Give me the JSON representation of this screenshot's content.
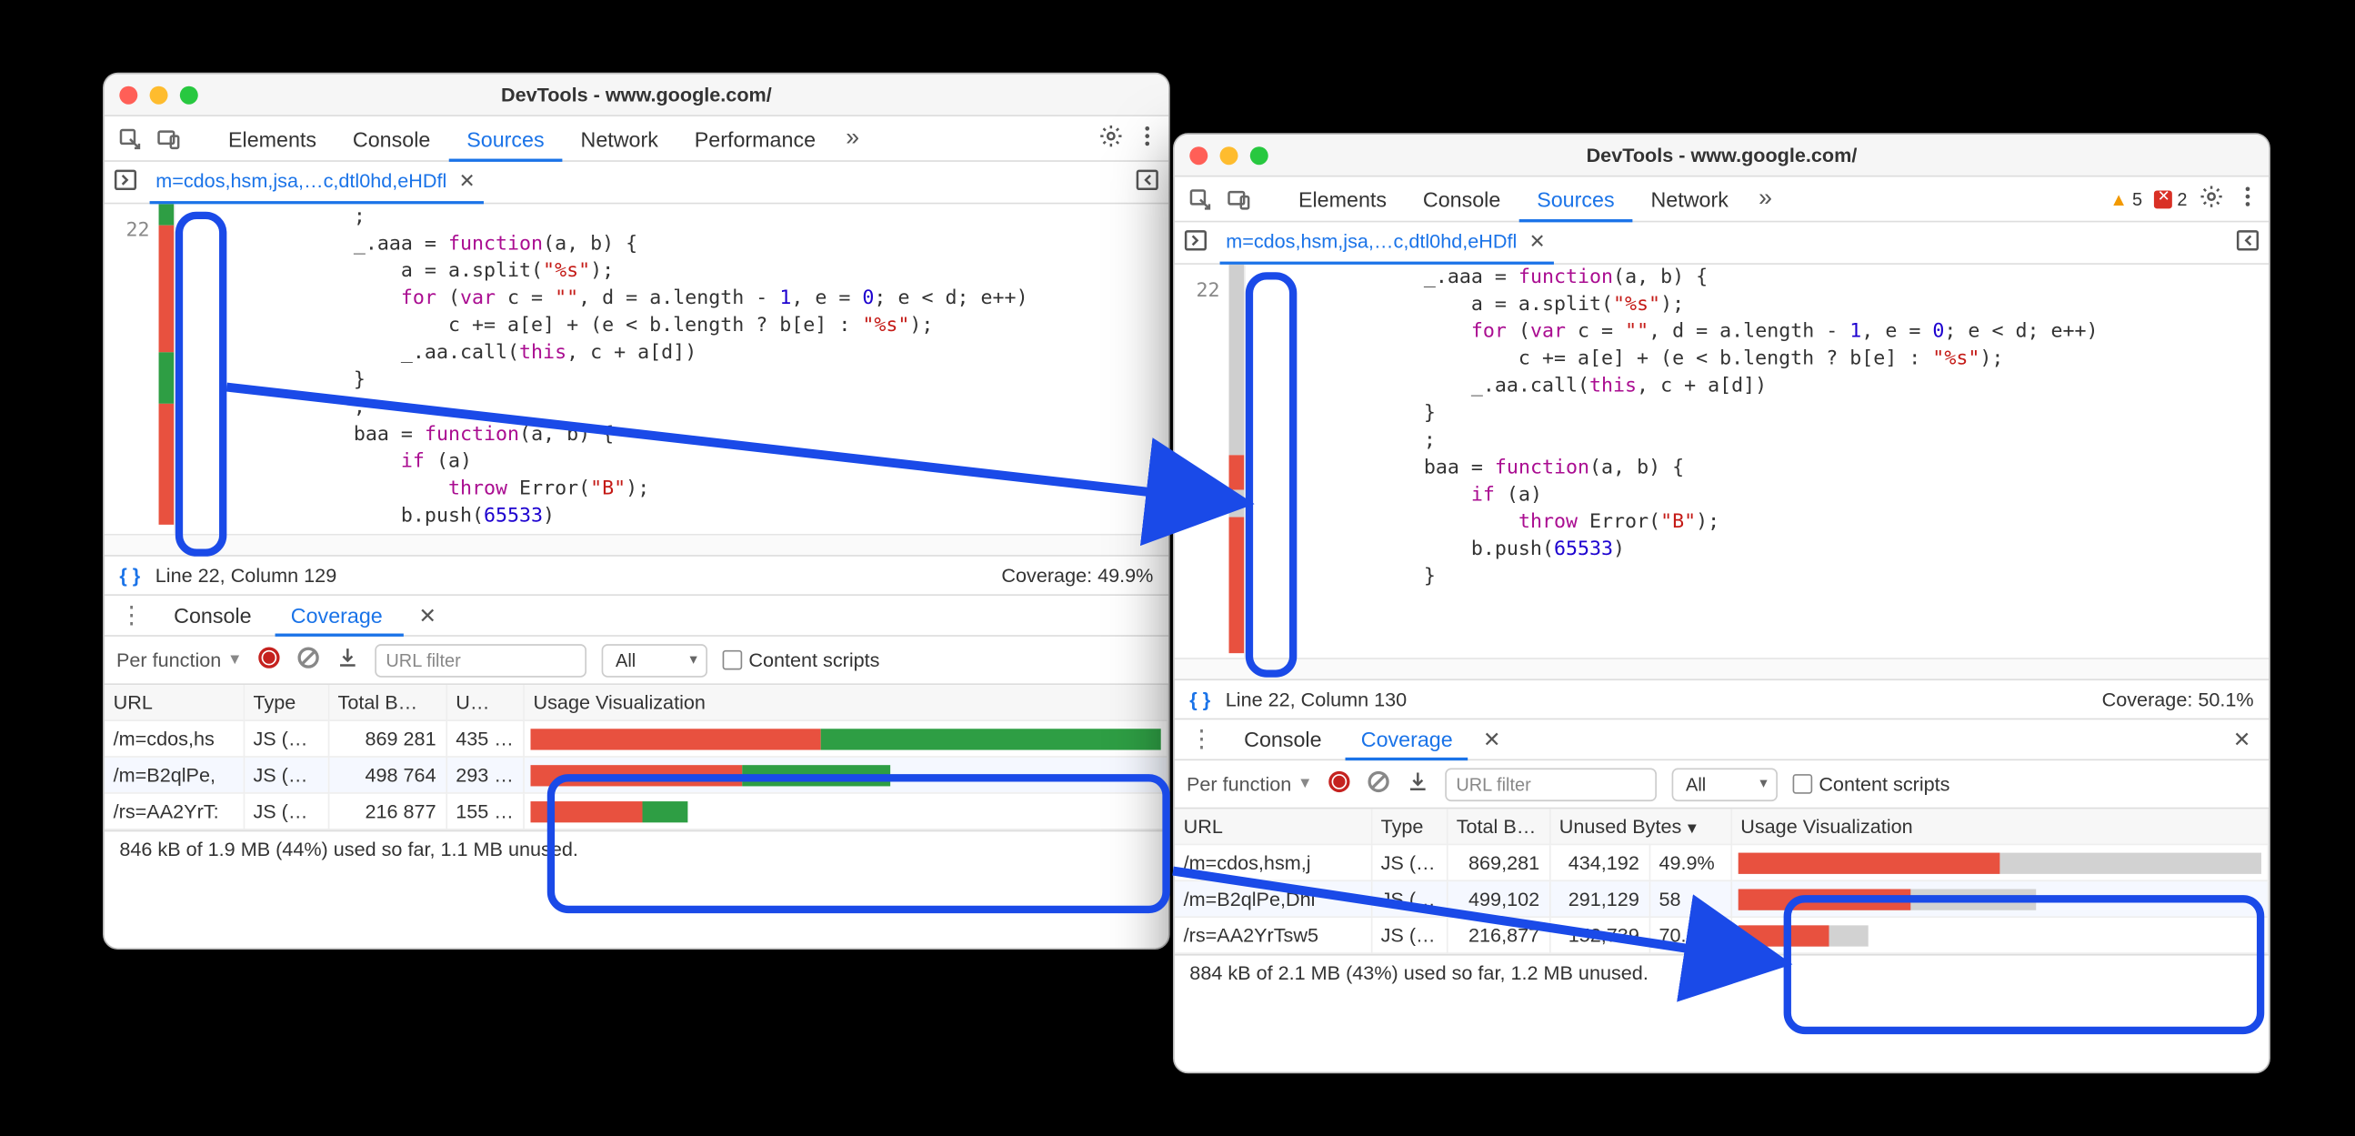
{
  "window_title": "DevTools - www.google.com/",
  "panels": {
    "elements": "Elements",
    "console": "Console",
    "sources": "Sources",
    "network": "Network",
    "performance": "Performance"
  },
  "issues": {
    "warnings": "5",
    "errors": "2"
  },
  "file_tab": "m=cdos,hsm,jsa,…c,dtl0hd,eHDfl",
  "line_number": "22",
  "code_lines": {
    "l0": "            ;",
    "l1a": "            _.aaa = ",
    "l1b": "function",
    "l1c": "(a, b) {",
    "l2a": "                a = a.split(",
    "l2b": "\"%s\"",
    "l2c": ");",
    "l3a": "                ",
    "l3b": "for",
    "l3c": " (",
    "l3d": "var",
    "l3e": " c = ",
    "l3f": "\"\"",
    "l3g": ", d = a.length - ",
    "l3h": "1",
    "l3i": ", e = ",
    "l3j": "0",
    "l3k": "; e < d; e++)",
    "l4a": "                    c += a[e] + (e < b.length ? b[e] : ",
    "l4b": "\"%s\"",
    "l4c": ");",
    "l5a": "                _.aa.call(",
    "l5b": "this",
    "l5c": ", c + a[d])",
    "l6": "            }",
    "l7": "            ;",
    "l8a": "            baa = ",
    "l8b": "function",
    "l8c": "(a, b) {",
    "l9a": "                ",
    "l9b": "if",
    "l9c": " (a)",
    "l10a": "                    ",
    "l10b": "throw",
    "l10c": " Error(",
    "l10d": "\"B\"",
    "l10e": ");",
    "l11a": "                b.push(",
    "l11b": "65533",
    "l11c": ")",
    "l12": "            }"
  },
  "left": {
    "status_line": "Line 22, Column 129",
    "coverage_pct": "Coverage: 49.9%",
    "coverage_summary": "846 kB of 1.9 MB (44%) used so far, 1.1 MB unused."
  },
  "right": {
    "status_line": "Line 22, Column 130",
    "coverage_pct": "Coverage: 50.1%",
    "coverage_summary": "884 kB of 2.1 MB (43%) used so far, 1.2 MB unused."
  },
  "drawer_tabs": {
    "console": "Console",
    "coverage": "Coverage"
  },
  "coverage_toolbar": {
    "scope": "Per function",
    "filter_placeholder": "URL filter",
    "type_all": "All",
    "content_scripts": "Content scripts"
  },
  "cov_headers": {
    "url": "URL",
    "type": "Type",
    "total_b": "Total B…",
    "u": "U…",
    "unused_b": "Unused Bytes",
    "usage": "Usage Visualization"
  },
  "left_rows": [
    {
      "url": "/m=cdos,hs",
      "type": "JS (…",
      "total": "869 281",
      "unused": "435 …",
      "red": 0.46,
      "green": 0.54,
      "width": 1.0
    },
    {
      "url": "/m=B2qlPe,",
      "type": "JS (…",
      "total": "498 764",
      "unused": "293 …",
      "red": 0.59,
      "green": 0.41,
      "width": 0.57
    },
    {
      "url": "/rs=AA2YrT:",
      "type": "JS (…",
      "total": "216 877",
      "unused": "155 …",
      "red": 0.71,
      "green": 0.29,
      "width": 0.25
    }
  ],
  "right_rows": [
    {
      "url": "/m=cdos,hsm,j",
      "type": "JS (…",
      "total": "869,281",
      "unused": "434,192",
      "pct": "49.9%",
      "red": 0.5,
      "width": 1.0
    },
    {
      "url": "/m=B2qlPe,Dhl",
      "type": "JS (…",
      "total": "499,102",
      "unused": "291,129",
      "pct": "58",
      "red": 0.58,
      "width": 0.57
    },
    {
      "url": "/rs=AA2YrTsw5",
      "type": "JS (…",
      "total": "216,877",
      "unused": "152,739",
      "pct": "70.4%",
      "red": 0.7,
      "width": 0.25
    }
  ]
}
